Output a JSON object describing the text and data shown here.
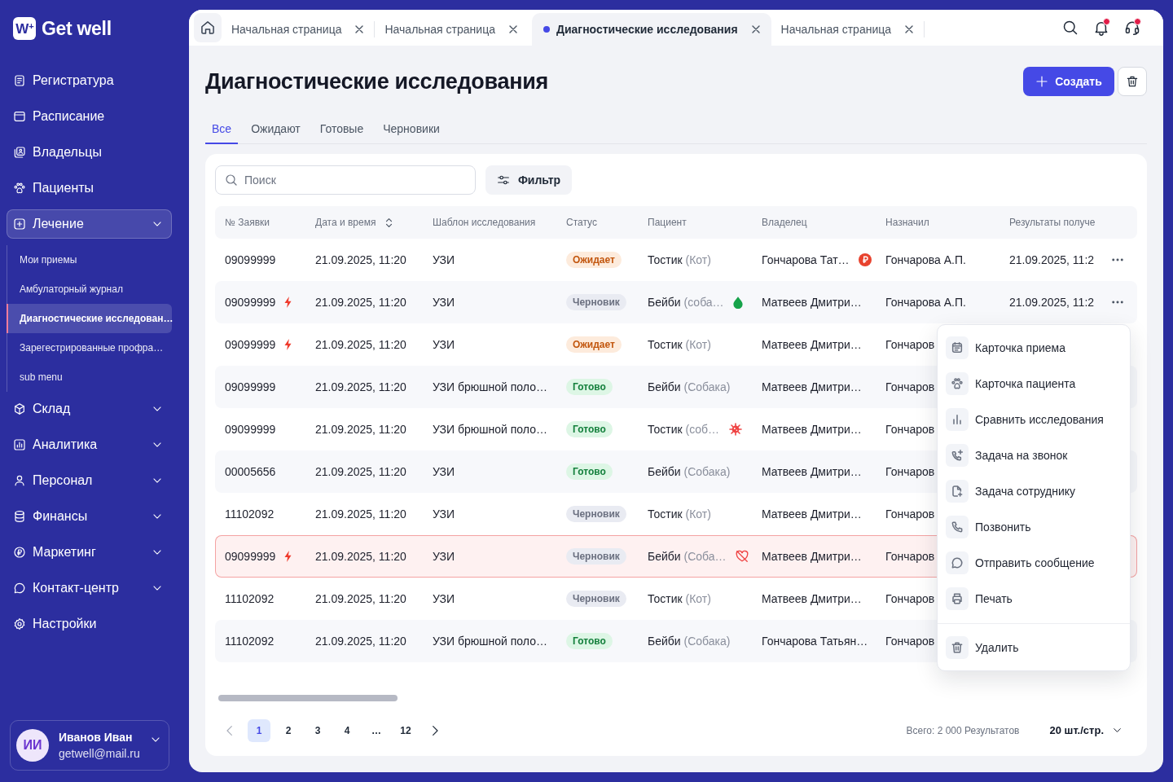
{
  "sidebar": {
    "logo": {
      "mark": "W$^{+}$",
      "name": "Get well"
    },
    "items": [
      {
        "label": "Регистратура"
      },
      {
        "label": "Расписание"
      },
      {
        "label": "Владельцы"
      },
      {
        "label": "Пациенты"
      },
      {
        "label": "Лечение",
        "expanded": true,
        "children": [
          {
            "label": "Мои приемы",
            "selected": false
          },
          {
            "label": "Амбулаторный журнал",
            "selected": false
          },
          {
            "label": "Диагностические исследован…",
            "selected": true
          },
          {
            "label": "Зарегестрированные профра…",
            "selected": false
          },
          {
            "label": "sub menu",
            "selected": false
          }
        ]
      },
      {
        "label": "Склад",
        "expanded": false
      },
      {
        "label": "Аналитика",
        "expanded": false
      },
      {
        "label": "Персонал",
        "expanded": false
      },
      {
        "label": "Финансы",
        "expanded": false
      },
      {
        "label": "Маркетинг",
        "expanded": false
      },
      {
        "label": "Контакт-центр",
        "expanded": false
      },
      {
        "label": "Настройки"
      }
    ],
    "user": {
      "initials": "ИИ",
      "name": "Иванов Иван",
      "email": "getwell@mail.ru"
    }
  },
  "tabs": [
    {
      "label": "Начальная страница",
      "selected": false
    },
    {
      "label": "Начальная страница",
      "selected": false
    },
    {
      "label": "Диагностические исследования",
      "selected": true
    },
    {
      "label": "Начальная страница",
      "selected": false
    }
  ],
  "top_actions": [
    {
      "kind": "search"
    },
    {
      "kind": "bell",
      "badge": true
    },
    {
      "kind": "headset",
      "badge": true
    }
  ],
  "page": {
    "title": "Диагностические исследования",
    "create_button": "Создать",
    "filter_tabs": [
      {
        "label": "Все",
        "selected": true
      },
      {
        "label": "Ожидают",
        "selected": false
      },
      {
        "label": "Готовые",
        "selected": false
      },
      {
        "label": "Черновики",
        "selected": false
      }
    ]
  },
  "toolbar": {
    "search": {
      "placeholder": "Поиск"
    },
    "filter_button": "Фильтр"
  },
  "table": {
    "columns": [
      {
        "label": "№ Заявки",
        "sortable": false
      },
      {
        "label": "Дата и время",
        "sortable": true
      },
      {
        "label": "Шаблон исследования",
        "sortable": false
      },
      {
        "label": "Статус",
        "sortable": false
      },
      {
        "label": "Пациент",
        "sortable": false
      },
      {
        "label": "Владелец",
        "sortable": false
      },
      {
        "label": "Назначил",
        "sortable": false
      },
      {
        "label": "Результаты получе",
        "sortable": false
      }
    ],
    "rows": [
      {
        "number": "09099999",
        "urgent": false,
        "date": "21.09.2025, 11:20",
        "template": "УЗИ",
        "status": {
          "label": "Ожидает",
          "kind": "waiting"
        },
        "patient": {
          "name": "Тостик",
          "species": "(Кот)"
        },
        "owner": "Гончарова Тат…",
        "owner_marker": {
          "kind": "ruble"
        },
        "assigned_by": "Гончарова А.П.",
        "results": "21.09.2025, 11:2",
        "more_button": true,
        "highlighted": false
      },
      {
        "number": "09099999",
        "urgent": true,
        "date": "21.09.2025, 11:20",
        "template": "УЗИ",
        "status": {
          "label": "Черновик",
          "kind": "draft"
        },
        "patient": {
          "name": "Бейби",
          "species": "(соба…"
        },
        "patient_marker": {
          "kind": "drop"
        },
        "owner": "Матвеев Дмитри…",
        "assigned_by": "Гончарова А.П.",
        "results": "21.09.2025, 11:2",
        "more_button": true,
        "highlighted": false
      },
      {
        "number": "09099999",
        "urgent": true,
        "date": "21.09.2025, 11:20",
        "template": "УЗИ",
        "status": {
          "label": "Ожидает",
          "kind": "waiting"
        },
        "patient": {
          "name": "Тостик",
          "species": "(Кот)"
        },
        "owner": "Матвеев Дмитри…",
        "assigned_by": "Гончаров",
        "highlighted": false
      },
      {
        "number": "09099999",
        "urgent": false,
        "date": "21.09.2025, 11:20",
        "template": "УЗИ брюшной поло…",
        "status": {
          "label": "Готово",
          "kind": "done"
        },
        "patient": {
          "name": "Бейби",
          "species": "(Собака)"
        },
        "owner": "Матвеев Дмитри…",
        "assigned_by": "Гончаров",
        "highlighted": false
      },
      {
        "number": "09099999",
        "urgent": false,
        "date": "21.09.2025, 11:20",
        "template": "УЗИ брюшной поло…",
        "status": {
          "label": "Готово",
          "kind": "done"
        },
        "patient": {
          "name": "Тостик",
          "species": "(соб…"
        },
        "patient_marker": {
          "kind": "virus"
        },
        "owner": "Матвеев Дмитри…",
        "assigned_by": "Гончаров",
        "highlighted": false
      },
      {
        "number": "00005656",
        "urgent": false,
        "date": "21.09.2025, 11:20",
        "template": "УЗИ",
        "status": {
          "label": "Готово",
          "kind": "done"
        },
        "patient": {
          "name": "Бейби",
          "species": "(Собака)"
        },
        "owner": "Матвеев Дмитри…",
        "assigned_by": "Гончаров",
        "highlighted": false
      },
      {
        "number": "11102092",
        "urgent": false,
        "date": "21.09.2025, 11:20",
        "template": "УЗИ",
        "status": {
          "label": "Черновик",
          "kind": "draft"
        },
        "patient": {
          "name": "Тостик",
          "species": "(Кот)"
        },
        "owner": "Матвеев Дмитри…",
        "assigned_by": "Гончаров",
        "highlighted": false
      },
      {
        "number": "09099999",
        "urgent": true,
        "date": "21.09.2025, 11:20",
        "template": "УЗИ",
        "status": {
          "label": "Черновик",
          "kind": "draft"
        },
        "patient": {
          "name": "Бейби",
          "species": "(Соба…"
        },
        "patient_marker": {
          "kind": "heart-off"
        },
        "owner": "Матвеев Дмитри…",
        "assigned_by": "Гончаров",
        "highlighted": true
      },
      {
        "number": "11102092",
        "urgent": false,
        "date": "21.09.2025, 11:20",
        "template": "УЗИ",
        "status": {
          "label": "Черновик",
          "kind": "draft"
        },
        "patient": {
          "name": "Тостик",
          "species": "(Кот)"
        },
        "owner": "Матвеев Дмитри…",
        "assigned_by": "Гончаров",
        "highlighted": false
      },
      {
        "number": "11102092",
        "urgent": false,
        "date": "21.09.2025, 11:20",
        "template": "УЗИ брюшной поло…",
        "status": {
          "label": "Готово",
          "kind": "done"
        },
        "patient": {
          "name": "Бейби",
          "species": "(Собака)"
        },
        "owner": "Гончарова Татьян…",
        "assigned_by": "Гончаров",
        "highlighted": false
      }
    ]
  },
  "context_menu": {
    "groups": [
      [
        "Карточка приема",
        "Карточка пациента",
        "Сравнить исследования",
        "Задача на звонок",
        "Задача сотруднику",
        "Позвонить",
        "Отправить сообщение",
        "Печать"
      ],
      [
        "Удалить"
      ]
    ]
  },
  "pagination": {
    "prev": {
      "disabled": true
    },
    "pages": [
      {
        "label": "1",
        "selected": true
      },
      {
        "label": "2",
        "selected": false
      },
      {
        "label": "3",
        "selected": false
      },
      {
        "label": "4",
        "selected": false
      },
      {
        "label": "…",
        "selected": false
      },
      {
        "label": "12",
        "selected": false
      }
    ],
    "next": {
      "disabled": false
    },
    "total": "Всего: 2 000 Результатов",
    "page_size": "20 шт./стр."
  }
}
